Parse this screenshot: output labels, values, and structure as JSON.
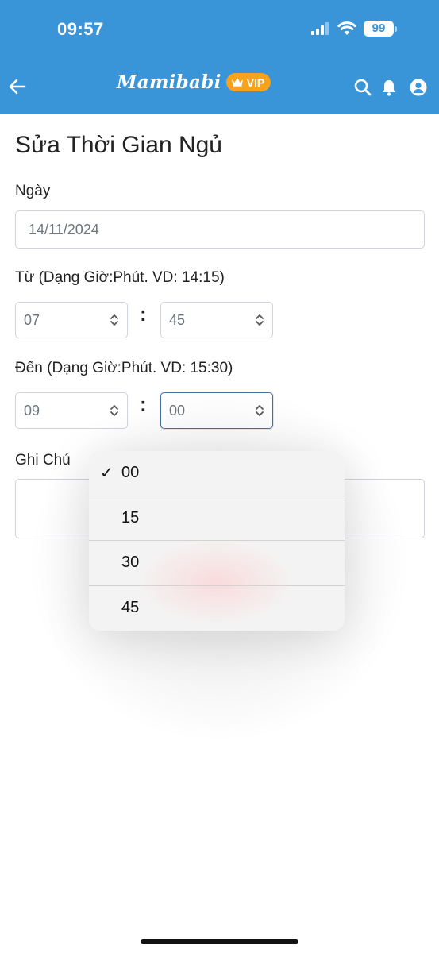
{
  "status_bar": {
    "time": "09:57",
    "battery": "99"
  },
  "header": {
    "app_name": "Mamibabi",
    "vip_label": "VIP"
  },
  "page": {
    "title": "Sửa Thời Gian Ngủ"
  },
  "form": {
    "date": {
      "label": "Ngày",
      "value": "14/11/2024"
    },
    "from": {
      "label": "Từ (Dạng Giờ:Phút. VD: 14:15)",
      "hour": "07",
      "minute": "45"
    },
    "to": {
      "label": "Đến (Dạng Giờ:Phút. VD: 15:30)",
      "hour": "09",
      "minute": "00"
    },
    "separator": ":",
    "note": {
      "label": "Ghi Chú",
      "value": ""
    }
  },
  "minute_dropdown": {
    "checkmark": "✓",
    "options": [
      "00",
      "15",
      "30",
      "45"
    ],
    "selected": "00"
  },
  "colors": {
    "header_bg": "#3a94d8",
    "vip_badge": "#f6a21b",
    "focus_border": "#4a6fa5"
  }
}
